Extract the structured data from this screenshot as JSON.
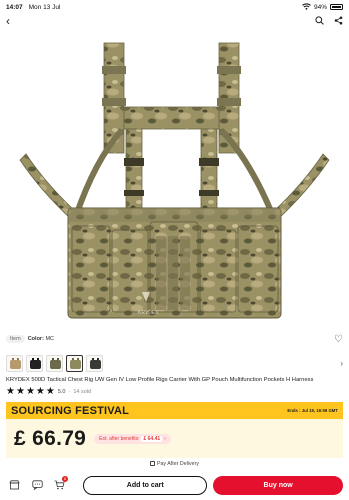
{
  "status_bar": {
    "time": "14:07",
    "date": "Mon 13 Jul",
    "battery": "94%"
  },
  "variant": {
    "chip_label": "Item",
    "color_key": "Color:",
    "color_value": "MC"
  },
  "swatches": [
    {
      "name": "coyote",
      "fill": "#b59a6c",
      "strap": "#8e7750"
    },
    {
      "name": "black",
      "fill": "#222222",
      "strap": "#111111"
    },
    {
      "name": "ranger-green",
      "fill": "#6c6a4c",
      "strap": "#55533a"
    },
    {
      "name": "multicam",
      "fill": "#8f8a5b",
      "strap": "#6e6a45",
      "selected": true
    },
    {
      "name": "multicam-black",
      "fill": "#3a3a36",
      "strap": "#2a2a27"
    }
  ],
  "product": {
    "title": "KRYDEX 500D Tactical Chest Rig UW Gen IV Low Profile Rigs Carrier With GP Pouch Multifunction Pockets H Harness",
    "rating": "5.0",
    "sold": "14 sold",
    "watermark": "KRYDEX"
  },
  "festival": {
    "name": "SOURCING FESTIVAL",
    "ends_label": "Ends : Jul 19, 16:59 GMT"
  },
  "price": {
    "main": "£ 66.79",
    "benefit_label": "Est. after benefits:",
    "benefit_amount": "£ 64.41"
  },
  "pay_after": "Pay After Delivery",
  "actions": {
    "cart_badge": "6",
    "add_to_cart": "Add to cart",
    "buy_now": "Buy now"
  },
  "colors": {
    "festival_bg": "#ffc51e",
    "buy_now_bg": "#e4102d",
    "price_bg": "#fff8e0"
  }
}
